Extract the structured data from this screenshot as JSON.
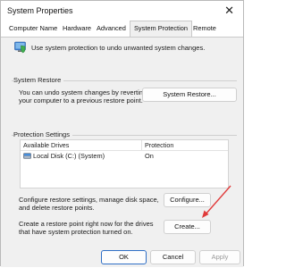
{
  "window": {
    "title": "System Properties",
    "close_glyph": "✕"
  },
  "tabs": [
    {
      "label": "Computer Name"
    },
    {
      "label": "Hardware"
    },
    {
      "label": "Advanced"
    },
    {
      "label": "System Protection"
    },
    {
      "label": "Remote"
    }
  ],
  "intro": {
    "text": "Use system protection to undo unwanted system changes.",
    "icon": "system-shield-icon"
  },
  "restore": {
    "group_label": "System Restore",
    "line1": "You can undo system changes by reverting",
    "line2": "your computer to a previous restore point.",
    "button": "System Restore..."
  },
  "protection": {
    "group_label": "Protection Settings",
    "headers": {
      "drives": "Available Drives",
      "protection": "Protection"
    },
    "rows": [
      {
        "drive": "Local Disk (C:) (System)",
        "protection": "On",
        "icon": "drive-icon"
      }
    ]
  },
  "configure": {
    "line1": "Configure restore settings, manage disk space,",
    "line2": "and delete restore points.",
    "button": "Configure..."
  },
  "create": {
    "line1": "Create a restore point right now for the drives",
    "line2": "that have system protection turned on.",
    "button": "Create..."
  },
  "footer": {
    "ok": "OK",
    "cancel": "Cancel",
    "apply": "Apply"
  },
  "colors": {
    "annotation_arrow": "#e03a3a",
    "window_bg": "#f0f0f0"
  }
}
